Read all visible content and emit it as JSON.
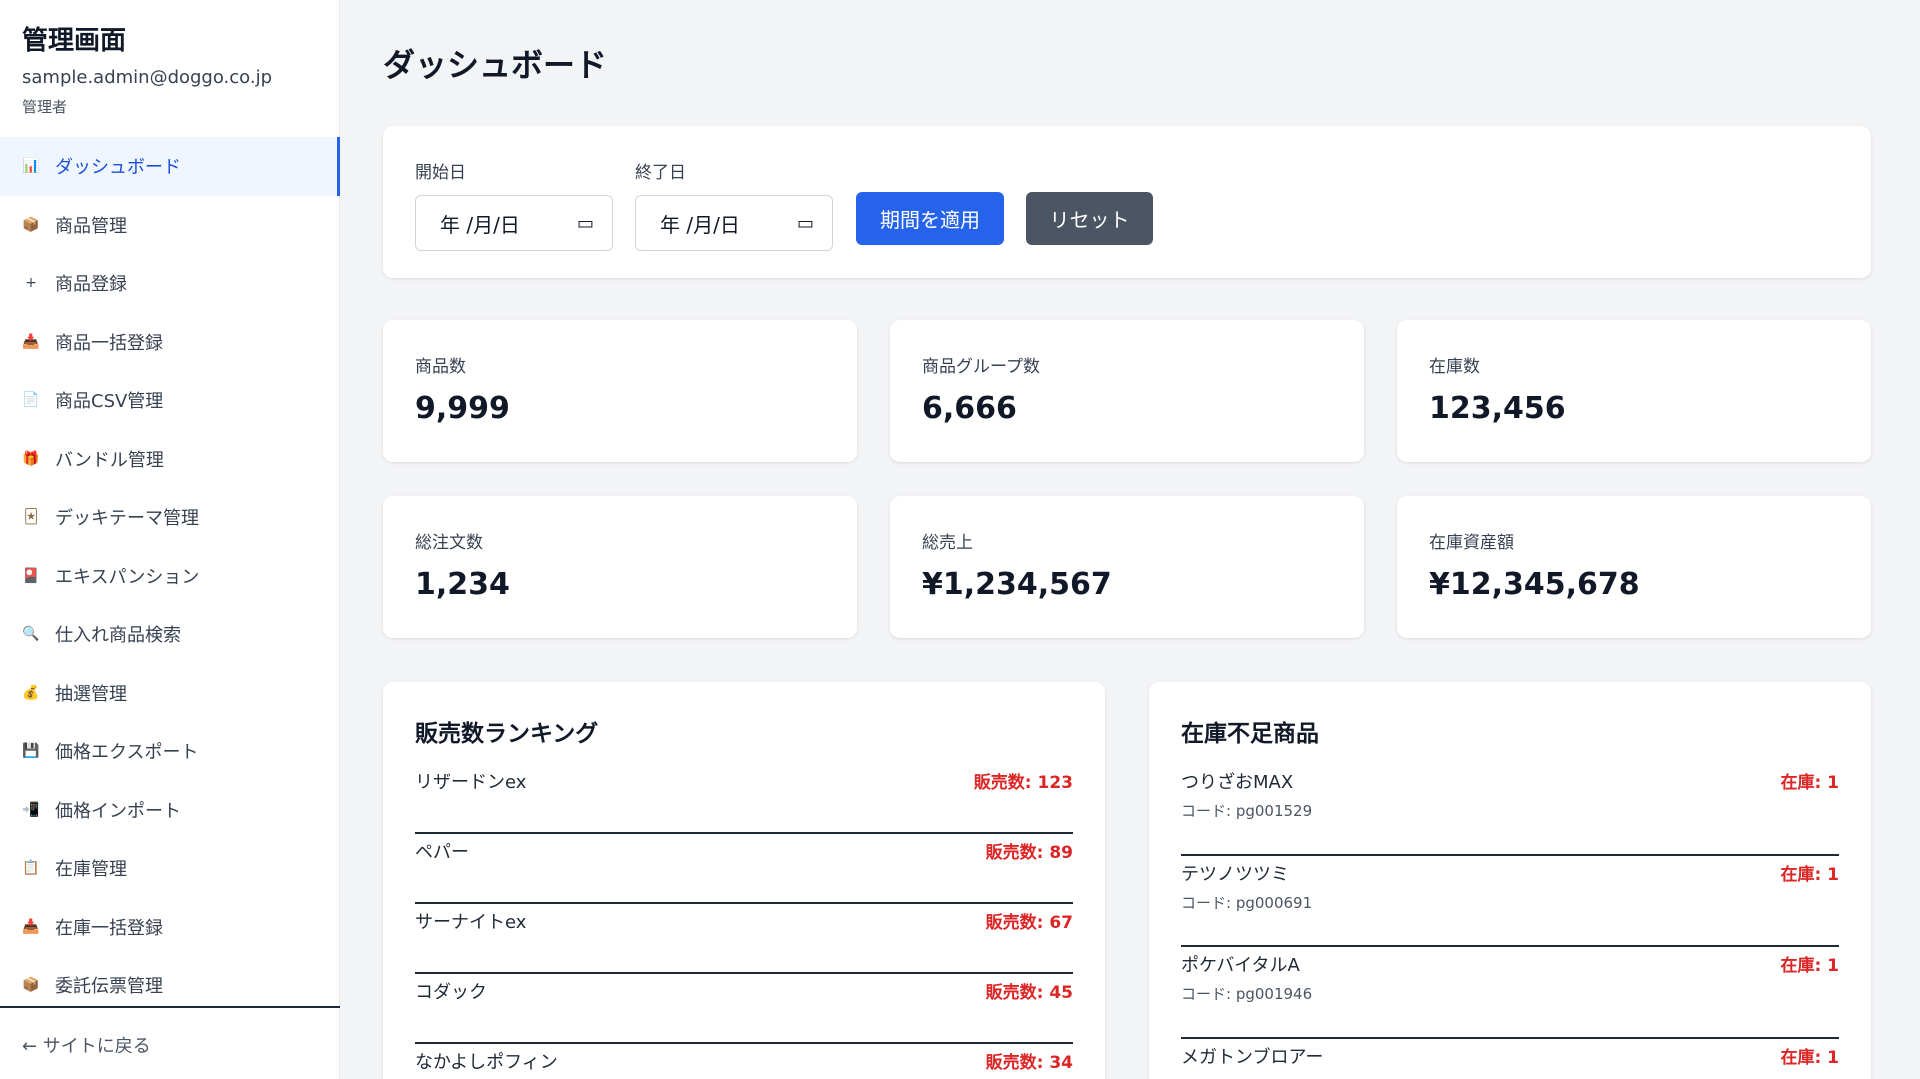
{
  "sidebar": {
    "title": "管理画面",
    "email": "sample.admin@doggo.co.jp",
    "role": "管理者",
    "items": [
      {
        "icon": "📊",
        "label": "ダッシュボード"
      },
      {
        "icon": "📦",
        "label": "商品管理"
      },
      {
        "icon": "+",
        "label": "商品登録"
      },
      {
        "icon": "📥",
        "label": "商品一括登録"
      },
      {
        "icon": "📄",
        "label": "商品CSV管理"
      },
      {
        "icon": "🎁",
        "label": "バンドル管理"
      },
      {
        "icon": "🃏",
        "label": "デッキテーマ管理"
      },
      {
        "icon": "🎴",
        "label": "エキスパンション"
      },
      {
        "icon": "🔍",
        "label": "仕入れ商品検索"
      },
      {
        "icon": "💰",
        "label": "抽選管理"
      },
      {
        "icon": "💾",
        "label": "価格エクスポート"
      },
      {
        "icon": "📲",
        "label": "価格インポート"
      },
      {
        "icon": "📋",
        "label": "在庫管理"
      },
      {
        "icon": "📥",
        "label": "在庫一括登録"
      },
      {
        "icon": "📦",
        "label": "委託伝票管理"
      }
    ],
    "back_link": "← サイトに戻る"
  },
  "main": {
    "title": "ダッシュボード",
    "filter": {
      "start_label": "開始日",
      "start_value": "年 /月/日",
      "end_label": "終了日",
      "end_value": "年 /月/日",
      "apply_label": "期間を適用",
      "reset_label": "リセット"
    },
    "stats": [
      {
        "label": "商品数",
        "value": "9,999"
      },
      {
        "label": "商品グループ数",
        "value": "6,666"
      },
      {
        "label": "在庫数",
        "value": "123,456"
      },
      {
        "label": "総注文数",
        "value": "1,234"
      },
      {
        "label": "総売上",
        "value": "¥1,234,567"
      },
      {
        "label": "在庫資産額",
        "value": "¥12,345,678"
      }
    ],
    "ranking": {
      "title": "販売数ランキング",
      "rows": [
        {
          "name": "リザードンex",
          "count": "販売数: 123"
        },
        {
          "name": "ペパー",
          "count": "販売数: 89"
        },
        {
          "name": "サーナイトex",
          "count": "販売数: 67"
        },
        {
          "name": "コダック",
          "count": "販売数: 45"
        },
        {
          "name": "なかよしポフィン",
          "count": "販売数: 34"
        }
      ]
    },
    "low_stock": {
      "title": "在庫不足商品",
      "rows": [
        {
          "name": "つりざおMAX",
          "code": "コード: pg001529",
          "count": "在庫: 1"
        },
        {
          "name": "テツノツツミ",
          "code": "コード: pg000691",
          "count": "在庫: 1"
        },
        {
          "name": "ポケバイタルA",
          "code": "コード: pg001946",
          "count": "在庫: 1"
        },
        {
          "name": "メガトンブロアー",
          "code": "",
          "count": "在庫: 1"
        }
      ]
    }
  },
  "colors": {
    "accent": "#2563eb",
    "alert": "#dc2626",
    "reset": "#4b5563",
    "background": "#f3f4f6"
  }
}
